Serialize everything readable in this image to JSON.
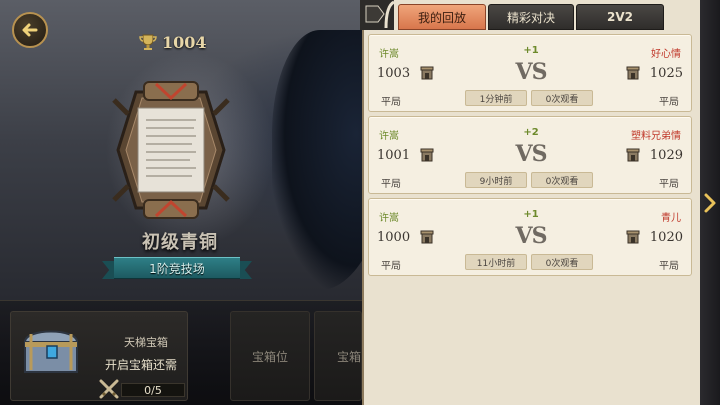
{
  "left": {
    "trophies": "1004",
    "rank_name": "初级青铜",
    "rank_tier": "1阶竞技场"
  },
  "chest_bar": {
    "title": "天梯宝箱",
    "desc": "开启宝箱还需",
    "progress": "0/5",
    "slot_label": "宝箱位",
    "slot_label_partial": "宝箱"
  },
  "tabs": [
    {
      "label": "我的回放",
      "active": true
    },
    {
      "label": "精彩对决",
      "active": false
    },
    {
      "label": "2V2",
      "active": false
    }
  ],
  "replays": [
    {
      "player1": "许嵩",
      "delta": "+1",
      "player2": "好心情",
      "score1": "1003",
      "score2": "1025",
      "vs": "VS",
      "result1": "平局",
      "result2": "平局",
      "time": "1分钟前",
      "views": "0次观看"
    },
    {
      "player1": "许嵩",
      "delta": "+2",
      "player2": "塑料兄弟情",
      "score1": "1001",
      "score2": "1029",
      "vs": "VS",
      "result1": "平局",
      "result2": "平局",
      "time": "9小时前",
      "views": "0次观看"
    },
    {
      "player1": "许嵩",
      "delta": "+1",
      "player2": "青儿",
      "score1": "1000",
      "score2": "1020",
      "vs": "VS",
      "result1": "平局",
      "result2": "平局",
      "time": "11小时前",
      "views": "0次观看"
    }
  ],
  "colors": {
    "tab_active": "#e08a5e",
    "player_self": "#6d8a2b",
    "player_opponent": "#c0392b",
    "panel_bg": "#e9e1cf"
  }
}
